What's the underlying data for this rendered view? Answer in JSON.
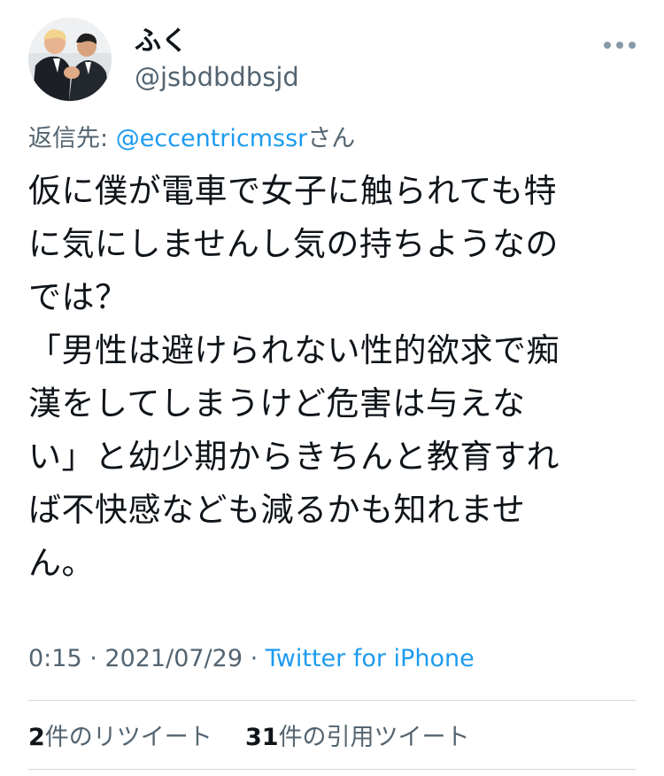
{
  "author": {
    "display_name": "ふく",
    "handle": "@jsbdbdbsjd",
    "avatar_icon": "avatar-photo"
  },
  "reply": {
    "prefix": "返信先: ",
    "mention": "@eccentricmssr",
    "suffix": "さん"
  },
  "tweet": {
    "text": "仮に僕が電車で女子に触られても特\nに気にしませんし気の持ちようなの\nでは？\n「男性は避けられない性的欲求で痴\n漢をしてしまうけど危害は与えな\nい」と幼少期からきちんと教育すれ\nば不快感なども減るかも知れませ\nん。"
  },
  "meta": {
    "time": "0:15",
    "sep1": " · ",
    "date": "2021/07/29",
    "sep2": " · ",
    "source": "Twitter for iPhone"
  },
  "stats": {
    "retweets_count": "2",
    "retweets_label": "件のリツイート",
    "quotes_count": "31",
    "quotes_label": "件の引用ツイート"
  },
  "colors": {
    "link": "#1d9bf0",
    "secondary_text": "#536471",
    "primary_text": "#0f1419",
    "divider": "#cfd9de"
  },
  "icons": {
    "more": "more-horizontal-icon"
  }
}
